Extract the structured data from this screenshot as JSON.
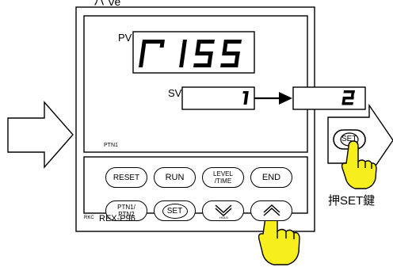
{
  "top_label": "ハ Ve",
  "controller": {
    "model": "REX-P96",
    "brand_mark": "RKC",
    "pv_label": "PV",
    "pv_display": "r155",
    "sv_label": "SV",
    "sv_from": "1",
    "sv_to": "2",
    "ptn_indicator": "PTN1"
  },
  "buttons": {
    "reset": "RESET",
    "run": "RUN",
    "level_line1": "LEVEL",
    "level_line2": "/TIME",
    "end": "END",
    "ptn_line1": "PTN1/",
    "ptn_line2": "PTN2",
    "set": "SET",
    "hold": "HOLD",
    "set_small": "SET"
  },
  "instruction": "押SET鍵"
}
